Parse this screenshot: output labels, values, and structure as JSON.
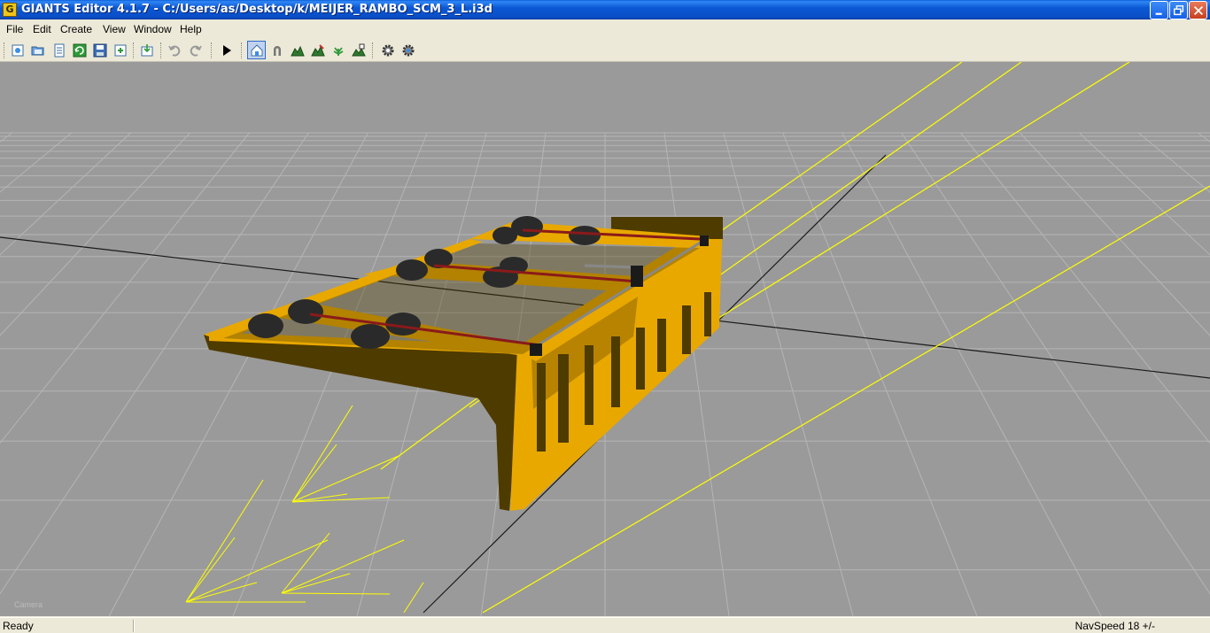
{
  "window": {
    "title": "GIANTS Editor 4.1.7 - C:/Users/as/Desktop/k/MEIJER_RAMBO_SCM_3_L.i3d",
    "app_icon_letter": "G"
  },
  "menu": [
    "File",
    "Edit",
    "Create",
    "View",
    "Window",
    "Help"
  ],
  "toolbar": {
    "icons": [
      "new-icon",
      "open-icon",
      "properties-icon",
      "refresh-icon",
      "save-icon",
      "import-icon",
      "undo-icon",
      "redo-icon",
      "play-icon",
      "home-icon",
      "magnet-icon",
      "terrain-icon",
      "terrain-paint-icon",
      "foliage-icon",
      "terrain-edit-icon",
      "settings-gear-icon",
      "settings-gear-2-icon"
    ]
  },
  "viewport": {
    "camera_label": "Camera",
    "background": "#9a9a9a",
    "grid_color": "#b5b5b5",
    "selection_color": "#ffff00",
    "model_color": "#e8a800"
  },
  "status": {
    "left": "Ready",
    "right": "NavSpeed 18 +/-"
  }
}
